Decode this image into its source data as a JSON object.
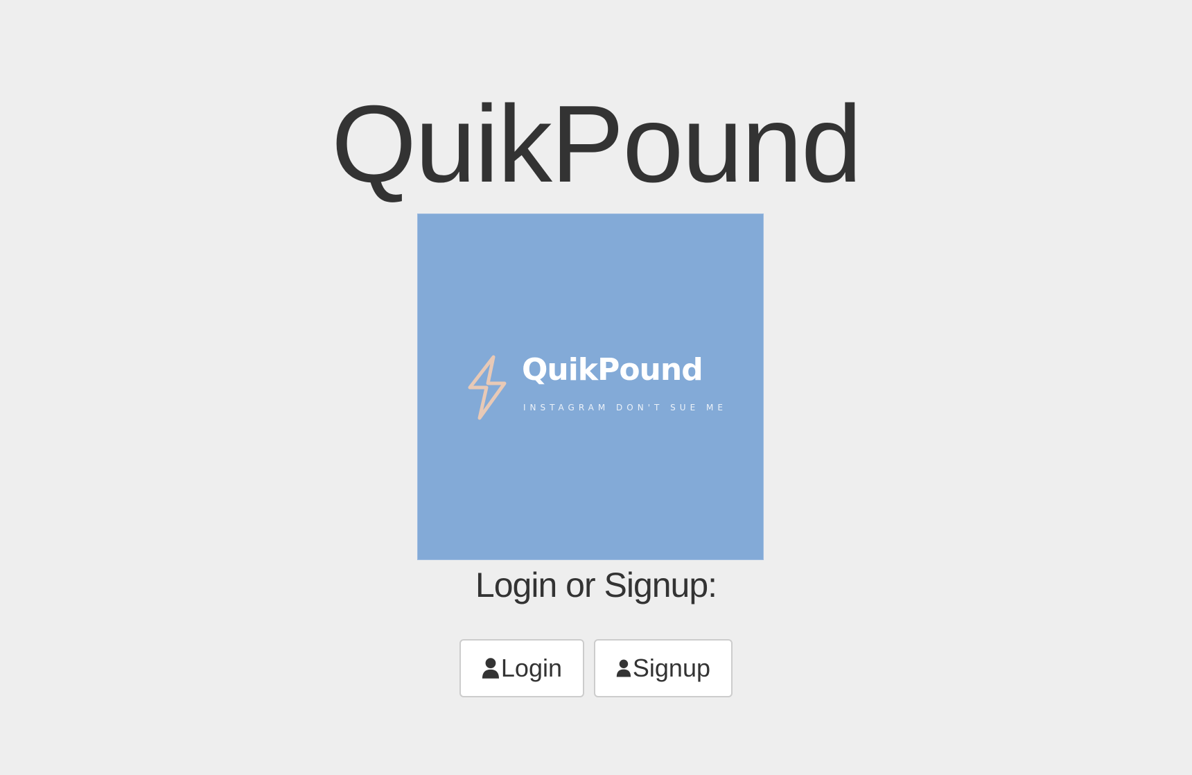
{
  "header": {
    "title": "QuikPound"
  },
  "logo": {
    "name": "QuikPound",
    "tagline": "INSTAGRAM DON'T SUE ME",
    "background_color": "#83aad7",
    "bolt_color": "#e8c9b6",
    "icon": "lightning-bolt-icon"
  },
  "auth": {
    "prompt": "Login or Signup:",
    "login_label": "Login",
    "signup_label": "Signup",
    "button_icon": "user-icon"
  }
}
